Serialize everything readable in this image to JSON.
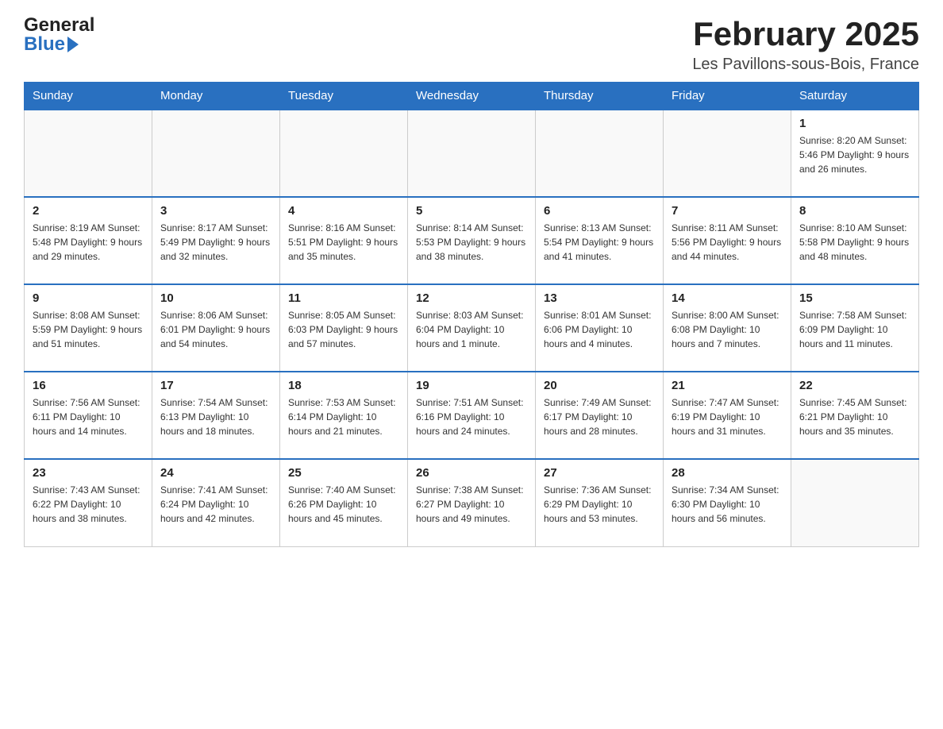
{
  "logo": {
    "general": "General",
    "blue": "Blue"
  },
  "title": "February 2025",
  "location": "Les Pavillons-sous-Bois, France",
  "weekdays": [
    "Sunday",
    "Monday",
    "Tuesday",
    "Wednesday",
    "Thursday",
    "Friday",
    "Saturday"
  ],
  "weeks": [
    [
      {
        "day": "",
        "info": ""
      },
      {
        "day": "",
        "info": ""
      },
      {
        "day": "",
        "info": ""
      },
      {
        "day": "",
        "info": ""
      },
      {
        "day": "",
        "info": ""
      },
      {
        "day": "",
        "info": ""
      },
      {
        "day": "1",
        "info": "Sunrise: 8:20 AM\nSunset: 5:46 PM\nDaylight: 9 hours and 26 minutes."
      }
    ],
    [
      {
        "day": "2",
        "info": "Sunrise: 8:19 AM\nSunset: 5:48 PM\nDaylight: 9 hours and 29 minutes."
      },
      {
        "day": "3",
        "info": "Sunrise: 8:17 AM\nSunset: 5:49 PM\nDaylight: 9 hours and 32 minutes."
      },
      {
        "day": "4",
        "info": "Sunrise: 8:16 AM\nSunset: 5:51 PM\nDaylight: 9 hours and 35 minutes."
      },
      {
        "day": "5",
        "info": "Sunrise: 8:14 AM\nSunset: 5:53 PM\nDaylight: 9 hours and 38 minutes."
      },
      {
        "day": "6",
        "info": "Sunrise: 8:13 AM\nSunset: 5:54 PM\nDaylight: 9 hours and 41 minutes."
      },
      {
        "day": "7",
        "info": "Sunrise: 8:11 AM\nSunset: 5:56 PM\nDaylight: 9 hours and 44 minutes."
      },
      {
        "day": "8",
        "info": "Sunrise: 8:10 AM\nSunset: 5:58 PM\nDaylight: 9 hours and 48 minutes."
      }
    ],
    [
      {
        "day": "9",
        "info": "Sunrise: 8:08 AM\nSunset: 5:59 PM\nDaylight: 9 hours and 51 minutes."
      },
      {
        "day": "10",
        "info": "Sunrise: 8:06 AM\nSunset: 6:01 PM\nDaylight: 9 hours and 54 minutes."
      },
      {
        "day": "11",
        "info": "Sunrise: 8:05 AM\nSunset: 6:03 PM\nDaylight: 9 hours and 57 minutes."
      },
      {
        "day": "12",
        "info": "Sunrise: 8:03 AM\nSunset: 6:04 PM\nDaylight: 10 hours and 1 minute."
      },
      {
        "day": "13",
        "info": "Sunrise: 8:01 AM\nSunset: 6:06 PM\nDaylight: 10 hours and 4 minutes."
      },
      {
        "day": "14",
        "info": "Sunrise: 8:00 AM\nSunset: 6:08 PM\nDaylight: 10 hours and 7 minutes."
      },
      {
        "day": "15",
        "info": "Sunrise: 7:58 AM\nSunset: 6:09 PM\nDaylight: 10 hours and 11 minutes."
      }
    ],
    [
      {
        "day": "16",
        "info": "Sunrise: 7:56 AM\nSunset: 6:11 PM\nDaylight: 10 hours and 14 minutes."
      },
      {
        "day": "17",
        "info": "Sunrise: 7:54 AM\nSunset: 6:13 PM\nDaylight: 10 hours and 18 minutes."
      },
      {
        "day": "18",
        "info": "Sunrise: 7:53 AM\nSunset: 6:14 PM\nDaylight: 10 hours and 21 minutes."
      },
      {
        "day": "19",
        "info": "Sunrise: 7:51 AM\nSunset: 6:16 PM\nDaylight: 10 hours and 24 minutes."
      },
      {
        "day": "20",
        "info": "Sunrise: 7:49 AM\nSunset: 6:17 PM\nDaylight: 10 hours and 28 minutes."
      },
      {
        "day": "21",
        "info": "Sunrise: 7:47 AM\nSunset: 6:19 PM\nDaylight: 10 hours and 31 minutes."
      },
      {
        "day": "22",
        "info": "Sunrise: 7:45 AM\nSunset: 6:21 PM\nDaylight: 10 hours and 35 minutes."
      }
    ],
    [
      {
        "day": "23",
        "info": "Sunrise: 7:43 AM\nSunset: 6:22 PM\nDaylight: 10 hours and 38 minutes."
      },
      {
        "day": "24",
        "info": "Sunrise: 7:41 AM\nSunset: 6:24 PM\nDaylight: 10 hours and 42 minutes."
      },
      {
        "day": "25",
        "info": "Sunrise: 7:40 AM\nSunset: 6:26 PM\nDaylight: 10 hours and 45 minutes."
      },
      {
        "day": "26",
        "info": "Sunrise: 7:38 AM\nSunset: 6:27 PM\nDaylight: 10 hours and 49 minutes."
      },
      {
        "day": "27",
        "info": "Sunrise: 7:36 AM\nSunset: 6:29 PM\nDaylight: 10 hours and 53 minutes."
      },
      {
        "day": "28",
        "info": "Sunrise: 7:34 AM\nSunset: 6:30 PM\nDaylight: 10 hours and 56 minutes."
      },
      {
        "day": "",
        "info": ""
      }
    ]
  ]
}
